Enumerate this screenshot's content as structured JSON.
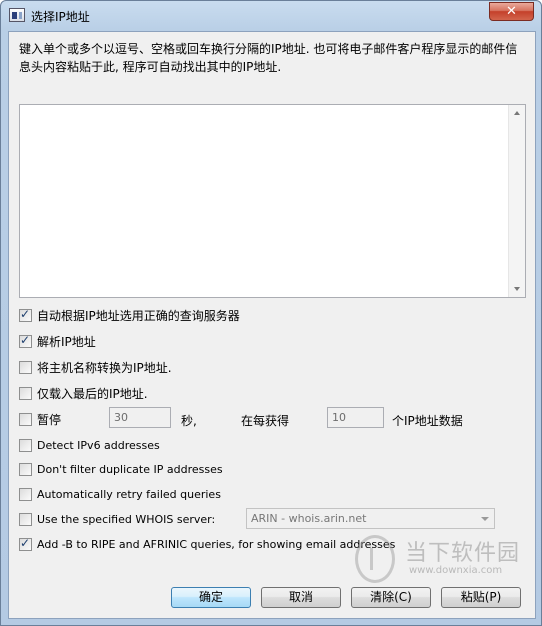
{
  "window": {
    "title": "选择IP地址",
    "close_label": "✕"
  },
  "description": "键入单个或多个以逗号、空格或回车换行分隔的IP地址. 也可将电子邮件客户程序显示的邮件信息头内容粘贴于此, 程序可自动找出其中的IP地址.",
  "input": {
    "value": ""
  },
  "options": [
    {
      "label": "自动根据IP地址选用正确的查询服务器",
      "checked": true
    },
    {
      "label": "解析IP地址",
      "checked": true
    },
    {
      "label": "将主机名称转换为IP地址.",
      "checked": false
    },
    {
      "label": "仅载入最后的IP地址.",
      "checked": false
    },
    {
      "label": "暂停",
      "checked": false
    },
    {
      "label": "Detect IPv6 addresses",
      "checked": false
    },
    {
      "label": "Don't filter duplicate IP addresses",
      "checked": false
    },
    {
      "label": "Automatically retry failed queries",
      "checked": false
    },
    {
      "label": "Use the specified WHOIS server:",
      "checked": false
    },
    {
      "label": "Add -B to RIPE and AFRINIC queries, for showing email addresses",
      "checked": true
    }
  ],
  "pause": {
    "seconds_value": "30",
    "seconds_unit": "秒,",
    "every_label": "在每获得",
    "count_value": "10",
    "count_unit": "个IP地址数据"
  },
  "whois_server": {
    "selected": "ARIN - whois.arin.net"
  },
  "buttons": {
    "ok": "确定",
    "cancel": "取消",
    "clear": "清除(C)",
    "paste": "粘贴(P)"
  },
  "watermark": {
    "text": "当下软件园",
    "sub": "www.downxia.com"
  }
}
